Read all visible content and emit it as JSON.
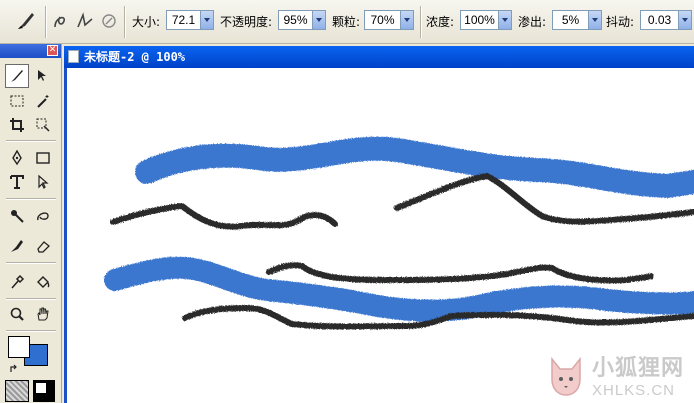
{
  "options_bar": {
    "size_label": "大小:",
    "size_value": "72.1",
    "opacity_label": "不透明度:",
    "opacity_value": "95%",
    "grain_label": "颗粒:",
    "grain_value": "70%",
    "concentration_label": "浓度:",
    "concentration_value": "100%",
    "bleed_label": "渗出:",
    "bleed_value": "5%",
    "jitter_label": "抖动:",
    "jitter_value": "0.03"
  },
  "document": {
    "title": "未标题-2 @ 100%"
  },
  "colors": {
    "foreground": "#ffffff",
    "background": "#2f6fd0",
    "blue_stroke": "#3a76cf",
    "dark_stroke": "#2b2b2b"
  },
  "watermark": {
    "line1": "小狐狸网",
    "line2": "XHLKS.CN"
  }
}
